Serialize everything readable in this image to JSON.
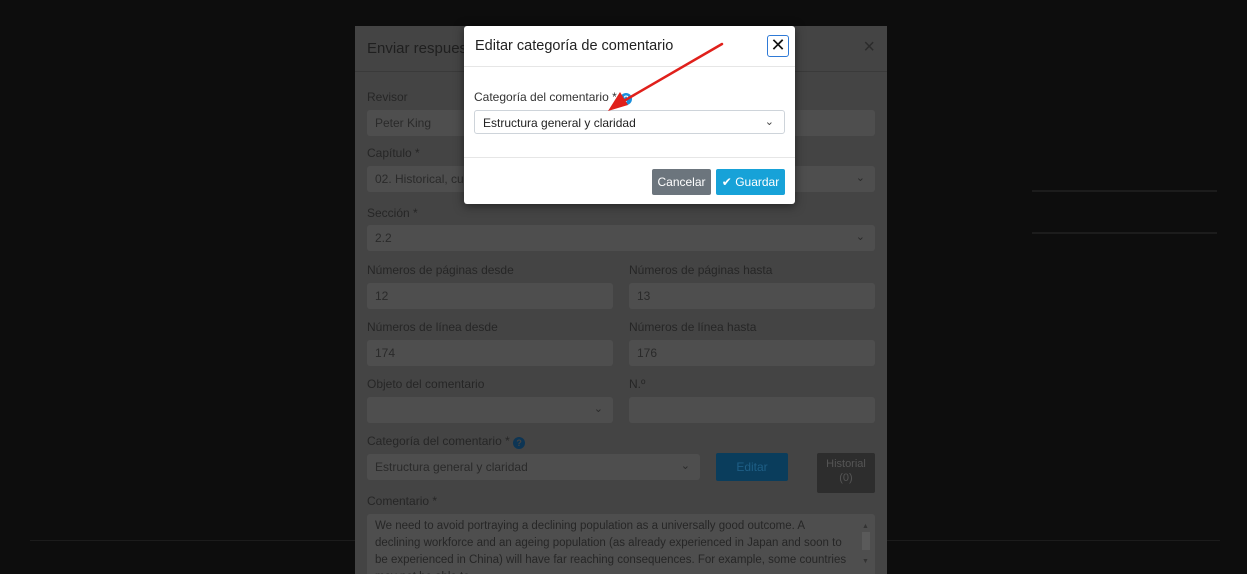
{
  "main_modal": {
    "title": "Enviar respuesta",
    "close_glyph": "×",
    "reviewer": {
      "label": "Revisor",
      "value": "Peter King"
    },
    "chapter": {
      "label": "Capítulo *",
      "value": "02. Historical, curre"
    },
    "section": {
      "label": "Sección *",
      "value": "2.2"
    },
    "page_from": {
      "label": "Números de páginas desde",
      "value": "12"
    },
    "page_to": {
      "label": "Números de páginas hasta",
      "value": "13"
    },
    "line_from": {
      "label": "Números de línea desde",
      "value": "174"
    },
    "line_to": {
      "label": "Números de línea hasta",
      "value": "176"
    },
    "comment_object": {
      "label": "Objeto del comentario",
      "value": ""
    },
    "number": {
      "label": "N.º",
      "value": ""
    },
    "category": {
      "label": "Categoría del comentario *",
      "value": "Estructura general y claridad"
    },
    "edit_button": "Editar",
    "history_button": {
      "line1": "Historial",
      "line2": "(0)"
    },
    "comment": {
      "label": "Comentario *",
      "text": "We need to avoid portraying a declining population as a universally good outcome.  A declining workforce and an ageing population (as already experienced in Japan and soon to be experienced in China) will have far reaching consequences. For example, some countries may not be able to"
    }
  },
  "dialog": {
    "title": "Editar categoría de comentario",
    "close_glyph": "✕",
    "field_label": "Categoría del comentario *",
    "help_glyph": "?",
    "selected_value": "Estructura general y claridad",
    "caret_glyph": "⌄",
    "cancel_label": "Cancelar",
    "save_icon": "✔",
    "save_label": "Guardar"
  },
  "icons": {
    "check": "check-icon",
    "close": "close-icon",
    "help": "question-circle-icon",
    "chevron": "chevron-down-icon"
  },
  "colors": {
    "primary": "#17a2d8",
    "secondary": "#6c757d",
    "help_icon": "#1a8fdc",
    "annotation_arrow": "#e0201b"
  }
}
